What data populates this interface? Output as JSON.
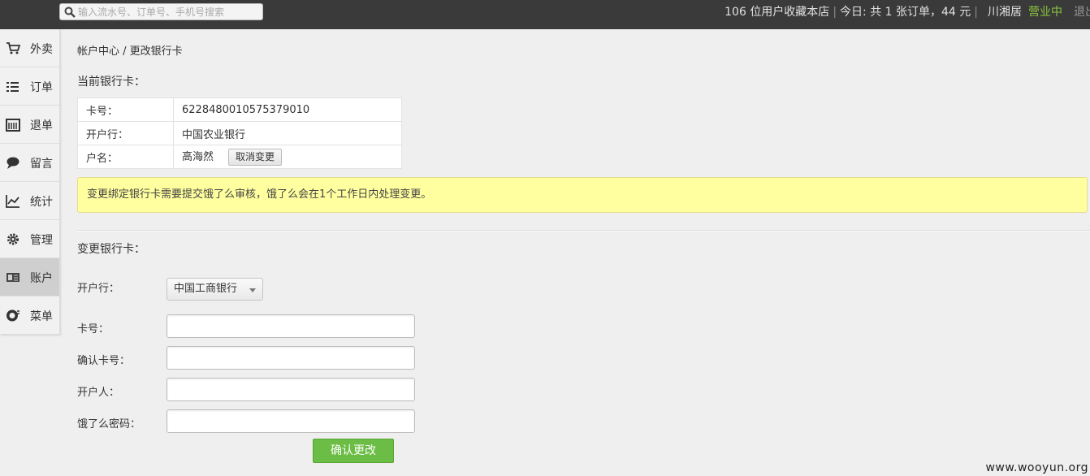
{
  "search": {
    "placeholder": "输入流水号、订单号、手机号搜索"
  },
  "topbar": {
    "favorites_text": "106 位用户收藏本店",
    "today_text": "今日: 共 1 张订单，44 元",
    "shop_name": "川湘居",
    "status": "营业中",
    "logout": "退出",
    "status_color": "#8cc63f"
  },
  "sidebar": {
    "items": [
      {
        "label": "外卖",
        "icon": "cart-icon"
      },
      {
        "label": "订单",
        "icon": "list-icon"
      },
      {
        "label": "退单",
        "icon": "calendar-icon"
      },
      {
        "label": "留言",
        "icon": "speech-bubble-icon"
      },
      {
        "label": "统计",
        "icon": "line-chart-icon"
      },
      {
        "label": "管理",
        "icon": "gear-icon"
      },
      {
        "label": "账户",
        "icon": "wallet-icon",
        "active": true
      },
      {
        "label": "菜单",
        "icon": "dish-icon"
      }
    ]
  },
  "breadcrumb": "帐户中心 / 更改银行卡",
  "current_card": {
    "title": "当前银行卡：",
    "rows": [
      {
        "key": "卡号：",
        "value": "6228480010575379010"
      },
      {
        "key": "开户行：",
        "value": "中国农业银行"
      },
      {
        "key": "户名：",
        "value": "高海然"
      }
    ],
    "cancel_label": "取消变更"
  },
  "notice": "变更绑定银行卡需要提交饿了么审核，饿了么会在1个工作日内处理变更。",
  "change_form": {
    "title": "变更银行卡：",
    "bank_label": "开户行：",
    "bank_value": "中国工商银行",
    "card_label": "卡号：",
    "confirm_card_label": "确认卡号：",
    "holder_label": "开户人：",
    "password_label": "饿了么密码：",
    "submit_label": "确认更改"
  },
  "watermark": "www.wooyun.org"
}
